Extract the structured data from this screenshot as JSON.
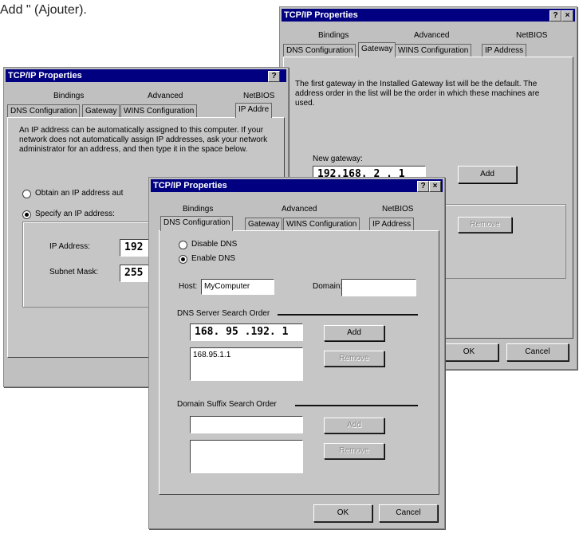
{
  "caption": "Add \" (Ajouter).",
  "window_right": {
    "title": "TCP/IP Properties",
    "tabs_back": [
      "Bindings",
      "Advanced",
      "NetBIOS"
    ],
    "tabs_front": [
      "DNS Configuration",
      "Gateway",
      "WINS Configuration",
      "IP Address"
    ],
    "description": "The first gateway in the Installed Gateway list will be the default. The address order in the list will be the order in which these machines are used.",
    "new_gateway_label": "New gateway:",
    "new_gateway_value": "192.168. 2 . 1",
    "add_button": "Add",
    "remove_button": "Remove",
    "ok_button": "OK",
    "cancel_button": "Cancel"
  },
  "window_left": {
    "title": "TCP/IP Properties",
    "tabs_back": [
      "Bindings",
      "Advanced",
      "NetBIOS"
    ],
    "tabs_front": [
      "DNS Configuration",
      "Gateway",
      "WINS Configuration",
      "IP Addre"
    ],
    "description": "An IP address can be automatically assigned to this computer. If your network does not automatically assign IP addresses, ask your network administrator for an address, and then type it in the space below.",
    "obtain_label": "Obtain an IP address aut",
    "specify_label": "Specify an IP address:",
    "ip_address_label": "IP Address:",
    "ip_address_value": "192",
    "subnet_label": "Subnet Mask:",
    "subnet_value": "255"
  },
  "window_front": {
    "title": "TCP/IP Properties",
    "tabs_back": [
      "Bindings",
      "Advanced",
      "NetBIOS"
    ],
    "tabs_front": [
      "DNS Configuration",
      "Gateway",
      "WINS Configuration",
      "IP Address"
    ],
    "disable_dns": "Disable DNS",
    "enable_dns": "Enable DNS",
    "host_label": "Host:",
    "host_value": "MyComputer",
    "domain_label": "Domain:",
    "domain_value": "",
    "dns_order_label": "DNS Server Search Order",
    "dns_server_value": "168. 95 .192. 1",
    "dns_add_button": "Add",
    "dns_list_item": "168.95.1.1",
    "dns_remove_button": "Remove",
    "suffix_label": "Domain Suffix Search Order",
    "suffix_value": "",
    "suffix_add_button": "Add",
    "suffix_remove_button": "Remove",
    "ok_button": "OK",
    "cancel_button": "Cancel"
  }
}
